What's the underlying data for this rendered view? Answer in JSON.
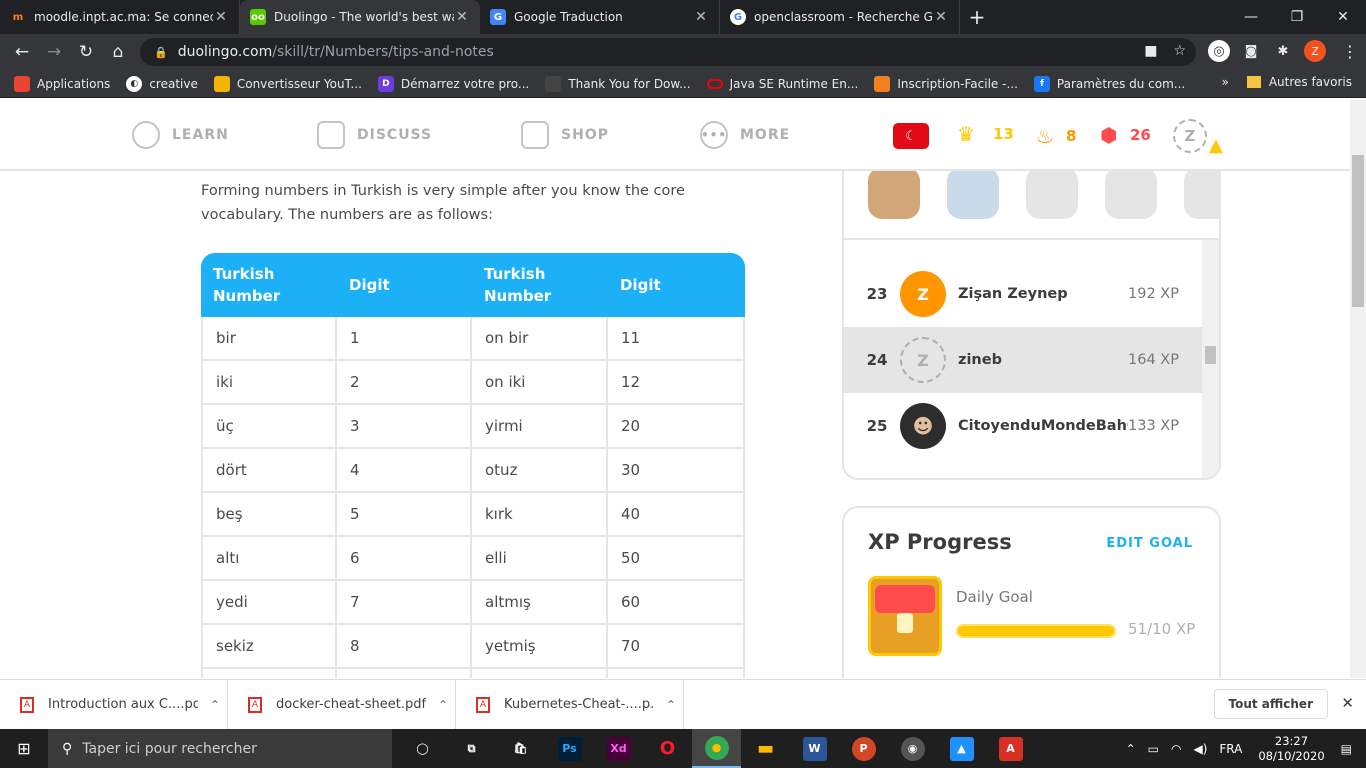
{
  "browser": {
    "tabs": [
      {
        "title": "moodle.inpt.ac.ma: Se connecter",
        "fav": "m",
        "fav_color": "#f98012"
      },
      {
        "title": "Duolingo - The world's best way",
        "fav": "oo",
        "fav_color": "#58cc02"
      },
      {
        "title": "Google Traduction",
        "fav": "G",
        "fav_color": "#4285f4"
      },
      {
        "title": "openclassroom - Recherche Goo",
        "fav": "G",
        "fav_color": "#ffffff"
      }
    ],
    "url_host": "duolingo.com",
    "url_path": "/skill/tr/Numbers/tips-and-notes",
    "profile_letter": "Z"
  },
  "bookmarks": {
    "items": [
      {
        "label": "Applications",
        "color": "#4285f4"
      },
      {
        "label": "creative",
        "color": "#ffffff"
      },
      {
        "label": "Convertisseur YouT...",
        "color": "#f4b400"
      },
      {
        "label": "Démarrez votre pro...",
        "color": "#6c3ce0"
      },
      {
        "label": "Thank You for Dow...",
        "color": "#444"
      },
      {
        "label": "Java SE Runtime En...",
        "color": "#f80000"
      },
      {
        "label": "Inscription-Facile -...",
        "color": "#f48024"
      },
      {
        "label": "Paramètres du com...",
        "color": "#1877f2"
      }
    ],
    "more": "»",
    "other": "Autres favoris"
  },
  "duo_header": {
    "nav": [
      "LEARN",
      "DISCUSS",
      "SHOP",
      "MORE"
    ],
    "crowns": "13",
    "streak": "8",
    "gems": "26",
    "avatar_letter": "Z"
  },
  "content": {
    "intro": "Forming numbers in Turkish is very simple after you know the core vocabulary. The numbers are as follows:",
    "table": {
      "headers": [
        "Turkish Number",
        "Digit",
        "Turkish Number",
        "Digit"
      ],
      "rows": [
        [
          "bir",
          "1",
          "on bir",
          "11"
        ],
        [
          "iki",
          "2",
          "on iki",
          "12"
        ],
        [
          "üç",
          "3",
          "yirmi",
          "20"
        ],
        [
          "dört",
          "4",
          "otuz",
          "30"
        ],
        [
          "beş",
          "5",
          "kırk",
          "40"
        ],
        [
          "altı",
          "6",
          "elli",
          "50"
        ],
        [
          "yedi",
          "7",
          "altmış",
          "60"
        ],
        [
          "sekiz",
          "8",
          "yetmiş",
          "70"
        ]
      ]
    }
  },
  "leaderboard": {
    "rows": [
      {
        "rank": "23",
        "avatar": "Z",
        "name": "Zişan Zeynep",
        "xp": "192 XP",
        "style": "orange"
      },
      {
        "rank": "24",
        "avatar": "Z",
        "name": "zineb",
        "xp": "164 XP",
        "style": "dash"
      },
      {
        "rank": "25",
        "avatar": "☻",
        "name": "CitoyenduMondeBahO",
        "xp": "133 XP",
        "style": "photo"
      }
    ]
  },
  "xp_progress": {
    "title": "XP Progress",
    "edit": "EDIT GOAL",
    "daily_goal_label": "Daily Goal",
    "value": "51/10 XP"
  },
  "downloads": {
    "items": [
      "Introduction aux C....pdf",
      "docker-cheat-sheet.pdf",
      "Kubernetes-Cheat-....p..."
    ],
    "show_all": "Tout afficher"
  },
  "taskbar": {
    "search_placeholder": "Taper ici pour rechercher",
    "apps": [
      {
        "label": "◯",
        "color": "transparent"
      },
      {
        "label": "⧉",
        "color": "transparent"
      },
      {
        "label": "🛍",
        "color": "transparent"
      },
      {
        "label": "Ps",
        "color": "#001e36"
      },
      {
        "label": "Xd",
        "color": "#470137"
      },
      {
        "label": "O",
        "color": "#ff1b2d"
      },
      {
        "label": "●",
        "color": "#34a853"
      },
      {
        "label": "▬",
        "color": "#ffb900"
      },
      {
        "label": "W",
        "color": "#2b579a"
      },
      {
        "label": "P",
        "color": "#d24726"
      },
      {
        "label": "◉",
        "color": "#555"
      },
      {
        "label": "▲",
        "color": "#1e90ff"
      },
      {
        "label": "A",
        "color": "#d93025"
      }
    ],
    "lang": "FRA",
    "time": "23:27",
    "date": "08/10/2020"
  }
}
